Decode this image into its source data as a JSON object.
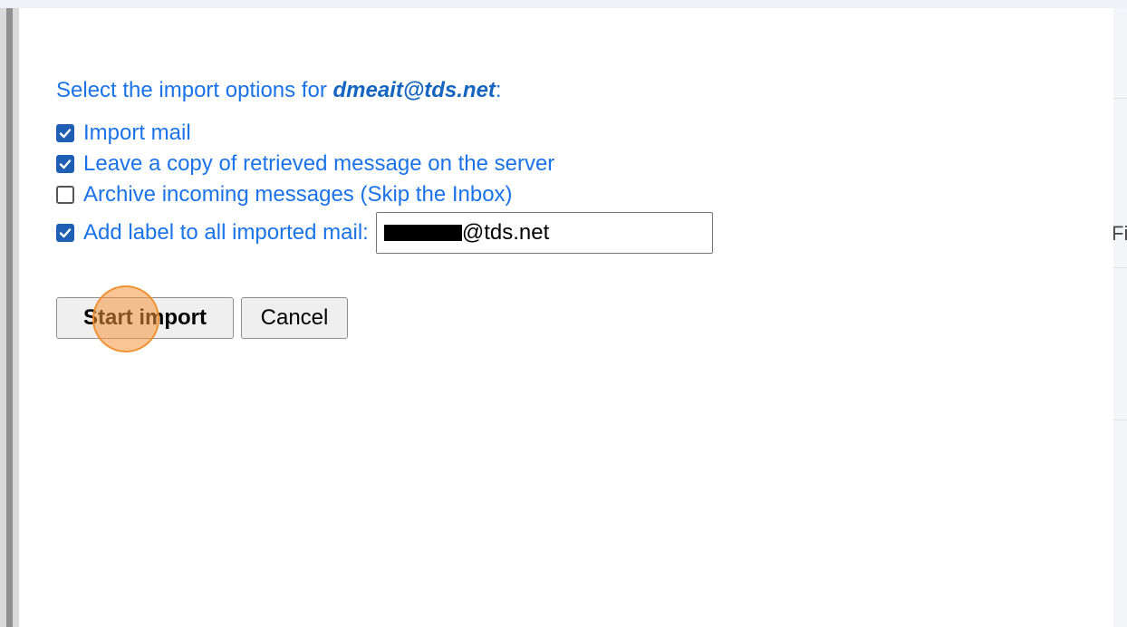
{
  "import_dialog": {
    "heading_prefix": "Select the import options for ",
    "account_email": "dmeait@tds.net",
    "heading_suffix": ":",
    "options": [
      {
        "label": "Import mail",
        "checked": true
      },
      {
        "label": "Leave a copy of retrieved message on the server",
        "checked": true
      },
      {
        "label": "Archive incoming messages (Skip the Inbox)",
        "checked": false
      },
      {
        "label": "Add label to all imported mail:",
        "checked": true
      }
    ],
    "label_field_value": "@tds.net",
    "start_import_label": "Start import",
    "cancel_label": "Cancel"
  },
  "background": {
    "clipped_text": "Fi"
  },
  "colors": {
    "link_blue": "#1a73e8",
    "checkbox_blue": "#1f5fb3",
    "click_marker": "#f4963c"
  }
}
